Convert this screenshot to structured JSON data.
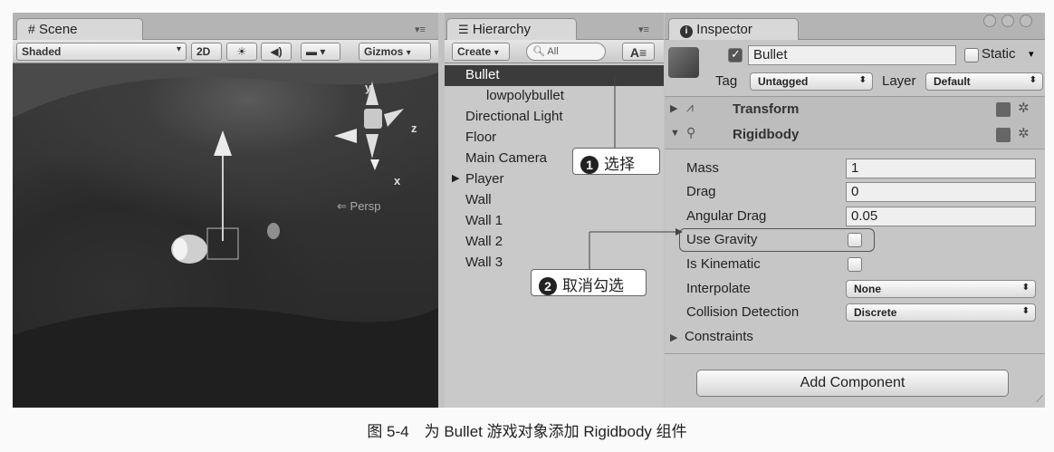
{
  "scene": {
    "tab_title": "Scene",
    "shading": "Shaded",
    "mode_2d": "2D",
    "gizmos": "Gizmos",
    "axis_y": "y",
    "axis_z": "z",
    "axis_x": "x",
    "persp": "Persp"
  },
  "hierarchy": {
    "tab_title": "Hierarchy",
    "create": "Create",
    "search_placeholder": "All",
    "items": [
      "Bullet",
      "lowpolybullet",
      "Directional Light",
      "Floor",
      "Main Camera",
      "Player",
      "Wall",
      "Wall 1",
      "Wall 2",
      "Wall 3"
    ]
  },
  "inspector": {
    "tab_title": "Inspector",
    "object_name": "Bullet",
    "static_label": "Static",
    "tag_label": "Tag",
    "tag_value": "Untagged",
    "layer_label": "Layer",
    "layer_value": "Default",
    "transform_title": "Transform",
    "rigidbody_title": "Rigidbody",
    "mass_label": "Mass",
    "mass_value": "1",
    "drag_label": "Drag",
    "drag_value": "0",
    "angular_drag_label": "Angular Drag",
    "angular_drag_value": "0.05",
    "use_gravity_label": "Use Gravity",
    "is_kinematic_label": "Is Kinematic",
    "interpolate_label": "Interpolate",
    "interpolate_value": "None",
    "collision_label": "Collision Detection",
    "collision_value": "Discrete",
    "constraints_label": "Constraints",
    "add_component": "Add Component"
  },
  "callouts": {
    "one_num": "1",
    "one_text": "选择",
    "two_num": "2",
    "two_text": "取消勾选"
  },
  "caption": "图 5-4　为 Bullet 游戏对象添加 Rigidbody 组件",
  "colors": {
    "selection": "#3b3b3b",
    "panel": "#c6c6c6",
    "viewport": "#2e2e2e"
  }
}
